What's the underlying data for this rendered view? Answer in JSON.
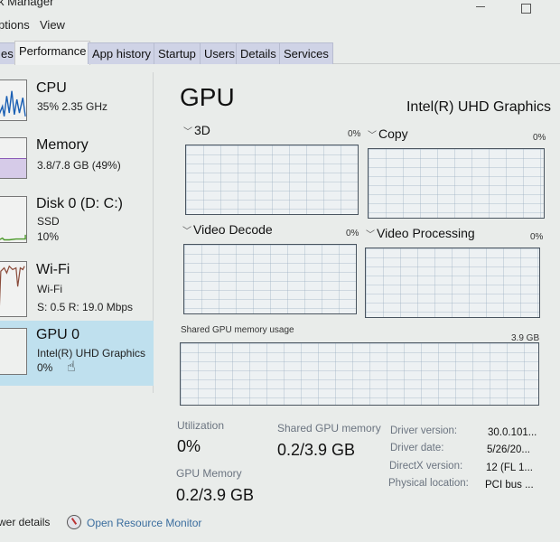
{
  "window": {
    "title": "Task Manager",
    "visible_title": "k Manager",
    "controls": {
      "minimize": "minimize-icon",
      "maximize": "maximize-icon"
    }
  },
  "menu": {
    "items": [
      "ptions",
      "View"
    ]
  },
  "tabs": [
    {
      "label": "es",
      "active": false
    },
    {
      "label": "Performance",
      "active": true
    },
    {
      "label": "App history",
      "active": false
    },
    {
      "label": "Startup",
      "active": false
    },
    {
      "label": "Users",
      "active": false
    },
    {
      "label": "Details",
      "active": false
    },
    {
      "label": "Services",
      "active": false
    }
  ],
  "sidebar": {
    "items": [
      {
        "name": "CPU",
        "line1": "35% 2.35 GHz",
        "line2": "",
        "graph_color": "#1a5fb4",
        "selected": false
      },
      {
        "name": "Memory",
        "line1": "3.8/7.8 GB (49%)",
        "line2": "",
        "graph_color": "#8b5bb8",
        "usage_fraction": 0.49,
        "selected": false
      },
      {
        "name": "Disk 0 (D: C:)",
        "line1": "SSD",
        "line2": "10%",
        "graph_color": "#4c9a2a",
        "selected": false
      },
      {
        "name": "Wi-Fi",
        "line1": "Wi-Fi",
        "line2": "S: 0.5 R: 19.0 Mbps",
        "graph_color": "#8a4b3a",
        "selected": false
      },
      {
        "name": "GPU 0",
        "line1": "Intel(R) UHD Graphics",
        "line2": "0%",
        "graph_color": "#1a8cbf",
        "selected": true
      }
    ]
  },
  "main": {
    "title": "GPU",
    "model": "Intel(R) UHD Graphics",
    "engines": [
      {
        "label": "3D",
        "percent": "0%"
      },
      {
        "label": "Copy",
        "percent": "0%"
      },
      {
        "label": "Video Decode",
        "percent": "0%"
      },
      {
        "label": "Video Processing",
        "percent": "0%"
      }
    ],
    "shared_memory_graph": {
      "label": "Shared GPU memory usage",
      "max": "3.9 GB"
    },
    "stats": {
      "utilization_label": "Utilization",
      "utilization_value": "0%",
      "shared_label": "Shared GPU memory",
      "shared_value": "0.2/3.9 GB",
      "gpu_memory_label": "GPU Memory",
      "gpu_memory_value": "0.2/3.9 GB"
    },
    "info": [
      {
        "key": "Driver version:",
        "value": "30.0.101..."
      },
      {
        "key": "Driver date:",
        "value": "5/26/20..."
      },
      {
        "key": "DirectX version:",
        "value": "12 (FL 1..."
      },
      {
        "key": "Physical location:",
        "value": "PCI bus ..."
      }
    ]
  },
  "footer": {
    "fewer_details": "wer details",
    "resource_monitor": "Open Resource Monitor"
  }
}
